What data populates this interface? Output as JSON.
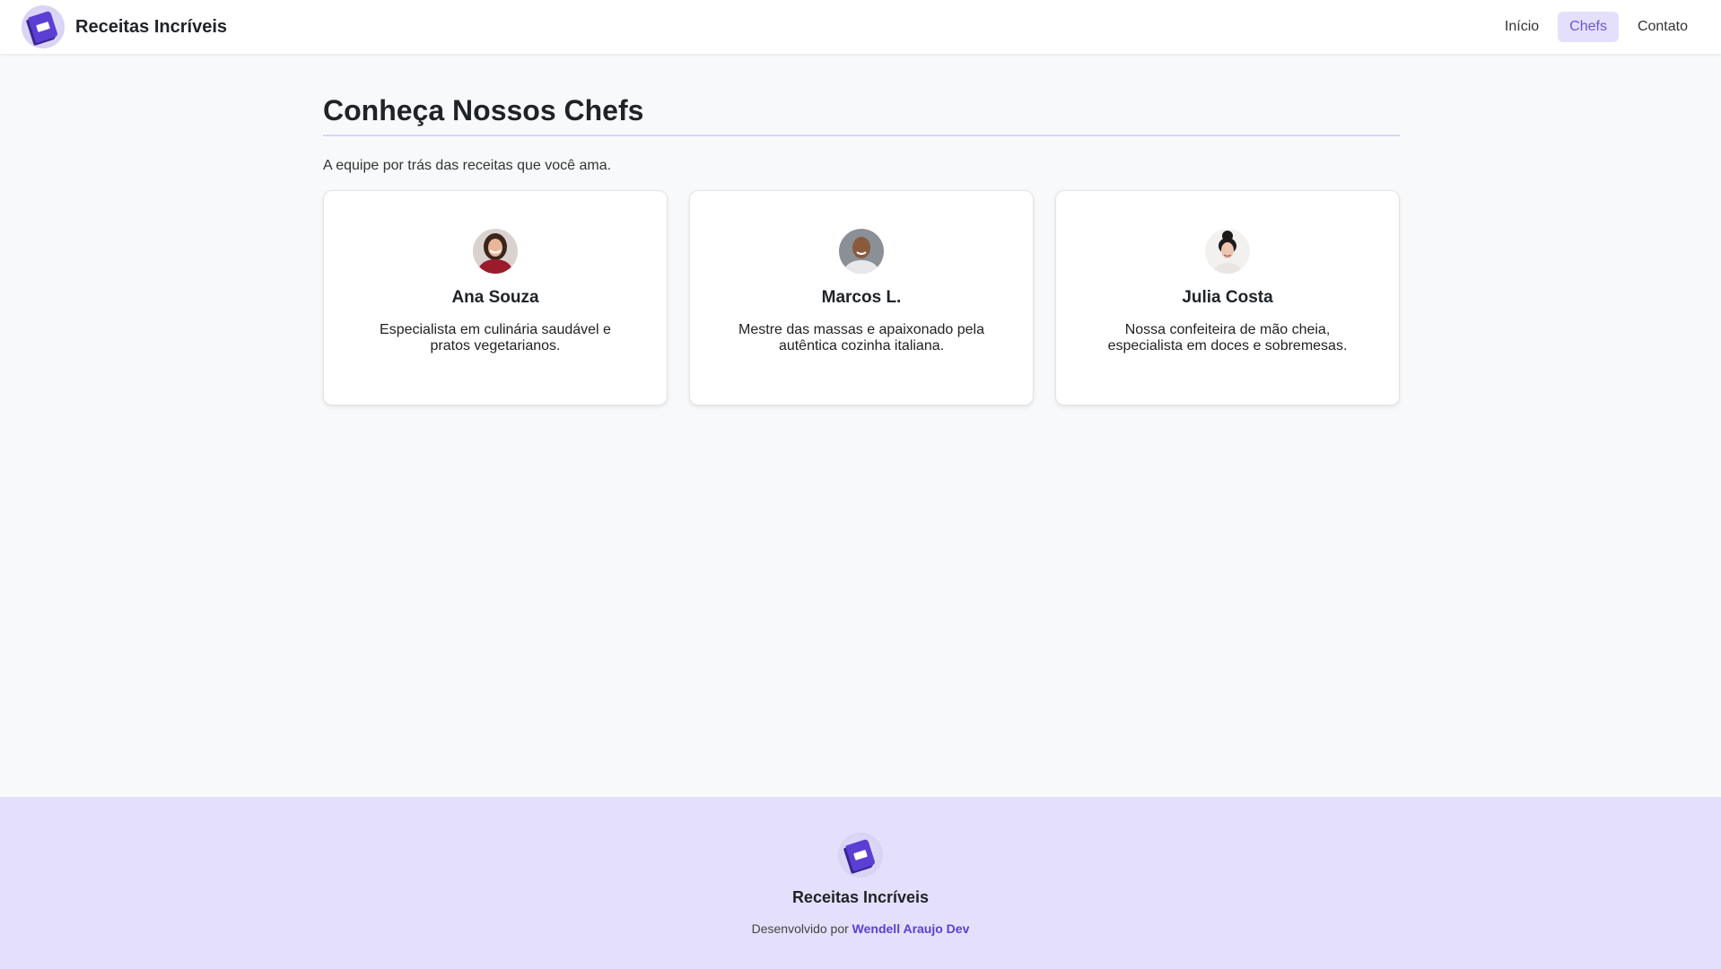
{
  "header": {
    "brand_name": "Receitas Incríveis",
    "nav": [
      {
        "label": "Início"
      },
      {
        "label": "Chefs",
        "active": true
      },
      {
        "label": "Contato"
      }
    ]
  },
  "main": {
    "title": "Conheça Nossos Chefs",
    "subtitle": "A equipe por trás das receitas que você ama.",
    "chefs": [
      {
        "name": "Ana Souza",
        "description": "Especialista em culinária saudável e pratos vegetarianos.",
        "avatar_icon": "chef-photo-ana"
      },
      {
        "name": "Marcos L.",
        "description": "Mestre das massas e apaixonado pela autêntica cozinha italiana.",
        "avatar_icon": "chef-photo-marcos"
      },
      {
        "name": "Julia Costa",
        "description": "Nossa confeiteira de mão cheia, especialista em doces e sobremesas.",
        "avatar_icon": "chef-photo-julia"
      }
    ]
  },
  "footer": {
    "brand_name": "Receitas Incríveis",
    "credit_prefix": "Desenvolvido por",
    "credit_link": "Wendell Araujo Dev"
  },
  "colors": {
    "accent": "#5b3fd4",
    "accent_light": "#e4e0fb",
    "nav_active_text": "#6a55d8",
    "page_background": "#f8f9fa"
  }
}
